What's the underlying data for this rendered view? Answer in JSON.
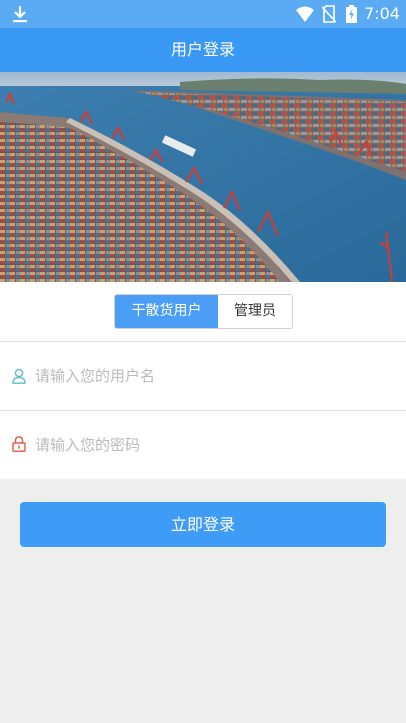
{
  "status_bar": {
    "time": "7:04",
    "icons": [
      "download-icon",
      "wifi-icon",
      "no-sim-icon",
      "battery-charging-icon"
    ]
  },
  "header": {
    "title": "用户登录"
  },
  "banner": {
    "image": "port-container-terminal-photo"
  },
  "role_switch": {
    "options": [
      {
        "label": "干散货用户",
        "selected": true
      },
      {
        "label": "管理员",
        "selected": false
      }
    ]
  },
  "form": {
    "username": {
      "placeholder": "请输入您的用户名",
      "value": "",
      "icon": "user-icon"
    },
    "password": {
      "placeholder": "请输入您的密码",
      "value": "",
      "icon": "lock-icon"
    }
  },
  "login_button": {
    "label": "立即登录"
  },
  "colors": {
    "status_bar": "#5aaaf4",
    "header": "#3a98f5",
    "primary": "#3f9cf6",
    "background": "#eeeeee",
    "user_icon": "#5bbcd0",
    "lock_icon": "#e25a4a"
  }
}
